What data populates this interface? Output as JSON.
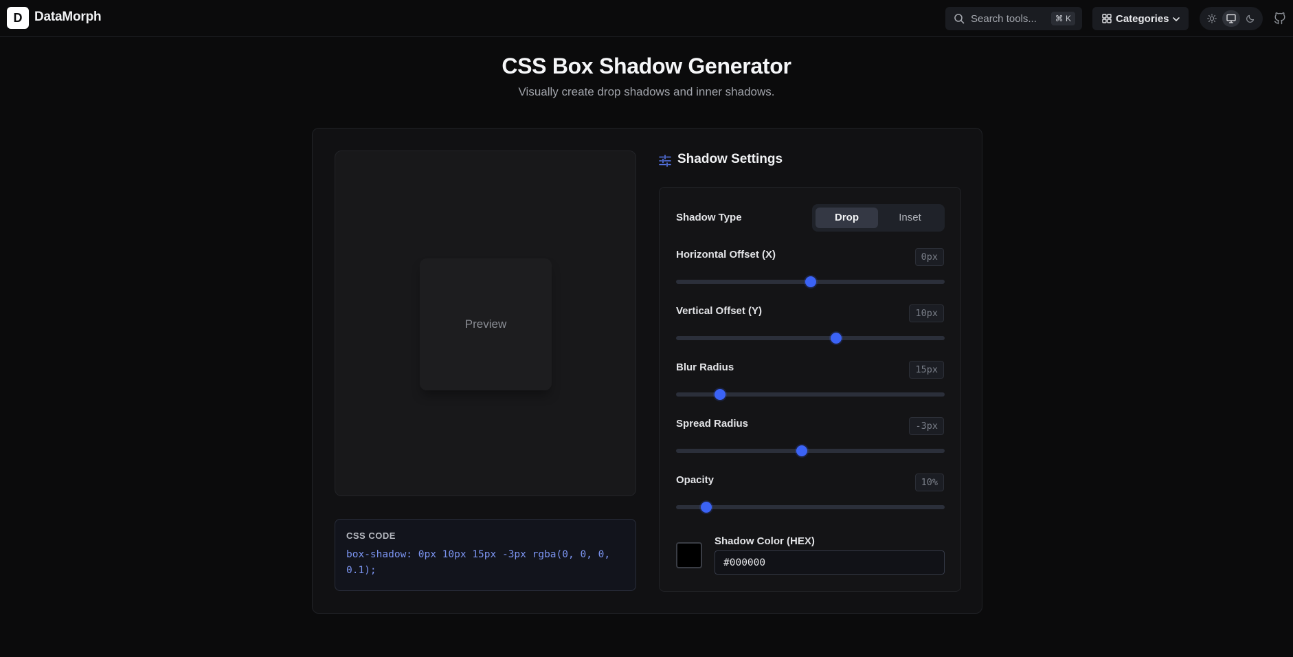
{
  "header": {
    "logo_letter": "D",
    "brand": "DataMorph",
    "search_placeholder": "Search tools...",
    "search_shortcut": "⌘ K",
    "categories_label": "Categories",
    "theme_options": [
      "light",
      "system",
      "dark"
    ],
    "theme_active": "system"
  },
  "page": {
    "title": "CSS Box Shadow Generator",
    "subtitle": "Visually create drop shadows and inner shadows."
  },
  "preview": {
    "label": "Preview"
  },
  "code": {
    "title": "CSS CODE",
    "value": "box-shadow: 0px 10px 15px -3px rgba(0, 0, 0, 0.1);"
  },
  "settings": {
    "heading": "Shadow Settings",
    "shadow_type_label": "Shadow Type",
    "shadow_type_options": [
      "Drop",
      "Inset"
    ],
    "shadow_type_selected": "Drop",
    "sliders": [
      {
        "label": "Horizontal Offset (X)",
        "display": "0px",
        "fraction": 0.5
      },
      {
        "label": "Vertical Offset (Y)",
        "display": "10px",
        "fraction": 0.595
      },
      {
        "label": "Blur Radius",
        "display": "15px",
        "fraction": 0.163
      },
      {
        "label": "Spread Radius",
        "display": "-3px",
        "fraction": 0.468
      },
      {
        "label": "Opacity",
        "display": "10%",
        "fraction": 0.113
      }
    ],
    "color_label": "Shadow Color (HEX)",
    "color_value": "#000000",
    "swatch_color": "#000000"
  },
  "colors": {
    "accent": "#3b63f6",
    "background": "#0b0b0c"
  }
}
